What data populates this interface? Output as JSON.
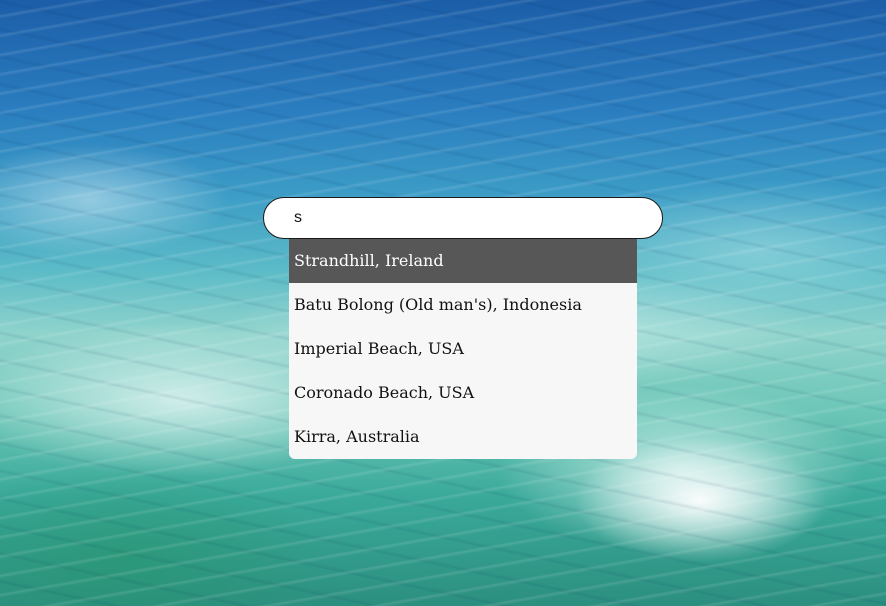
{
  "search": {
    "value": "s",
    "suggestions": [
      "Strandhill, Ireland",
      "Batu Bolong (Old man's), Indonesia",
      "Imperial Beach, USA",
      "Coronado Beach, USA",
      "Kirra, Australia"
    ],
    "active_index": 0
  },
  "colors": {
    "active_item_bg": "#575757",
    "dropdown_bg": "#f7f7f7",
    "input_border": "#1a1a1a"
  }
}
